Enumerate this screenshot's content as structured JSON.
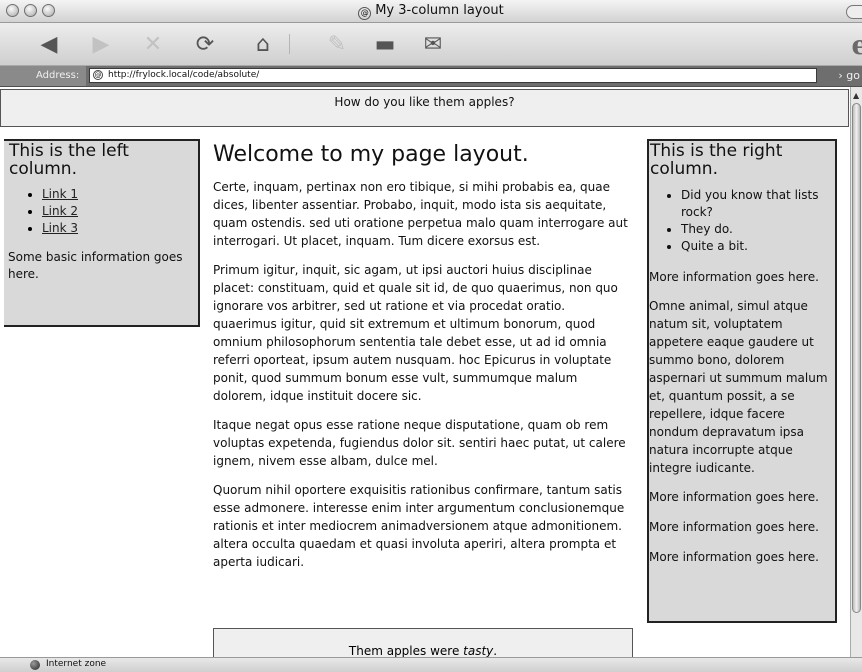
{
  "window": {
    "title": "My 3-column layout"
  },
  "toolbar": {
    "back": "◀",
    "forward": "▶",
    "stop": "✕",
    "refresh": "⟳",
    "home": "⌂",
    "autofill": "✎",
    "print": "▬",
    "mail": "✉",
    "logo": "e"
  },
  "address": {
    "label": "Address:",
    "url": "http://frylock.local/code/absolute/",
    "go": "go"
  },
  "page": {
    "header": "How do you like them apples?",
    "left": {
      "heading": "This is the left column.",
      "links": [
        "Link 1",
        "Link 2",
        "Link 3"
      ],
      "info": "Some basic information goes here."
    },
    "main": {
      "title": "Welcome to my page layout.",
      "paragraphs": [
        "Certe, inquam, pertinax non ero tibique, si mihi probabis ea, quae dices, libenter assentiar. Probabo, inquit, modo ista sis aequitate, quam ostendis. sed uti oratione perpetua malo quam interrogare aut interrogari. Ut placet, inquam. Tum dicere exorsus est.",
        "Primum igitur, inquit, sic agam, ut ipsi auctori huius disciplinae placet: constituam, quid et quale sit id, de quo quaerimus, non quo ignorare vos arbitrer, sed ut ratione et via procedat oratio. quaerimus igitur, quid sit extremum et ultimum bonorum, quod omnium philosophorum sententia tale debet esse, ut ad id omnia referri oporteat, ipsum autem nusquam. hoc Epicurus in voluptate ponit, quod summum bonum esse vult, summumque malum dolorem, idque instituit docere sic.",
        "Itaque negat opus esse ratione neque disputatione, quam ob rem voluptas expetenda, fugiendus dolor sit. sentiri haec putat, ut calere ignem, nivem esse albam, dulce mel.",
        "Quorum nihil oportere exquisitis rationibus confirmare, tantum satis esse admonere. interesse enim inter argumentum conclusionemque rationis et inter mediocrem animadversionem atque admonitionem. altera occulta quaedam et quasi involuta aperiri, altera prompta et aperta iudicari."
      ]
    },
    "footer": {
      "prefix": "Them apples were ",
      "emphasis": "tasty",
      "suffix": "."
    },
    "right": {
      "heading": "This is the right column.",
      "bullets": [
        "Did you know that lists rock?",
        "They do.",
        "Quite a bit."
      ],
      "info1": "More information goes here.",
      "latin": "Omne animal, simul atque natum sit, voluptatem appetere eaque gaudere ut summo bono, dolorem aspernari ut summum malum et, quantum possit, a se repellere, idque facere nondum depravatum ipsa natura incorrupte atque integre iudicante.",
      "info2": "More information goes here.",
      "info3": "More information goes here.",
      "info4": "More information goes here."
    }
  },
  "status": {
    "zone": "Internet zone"
  }
}
